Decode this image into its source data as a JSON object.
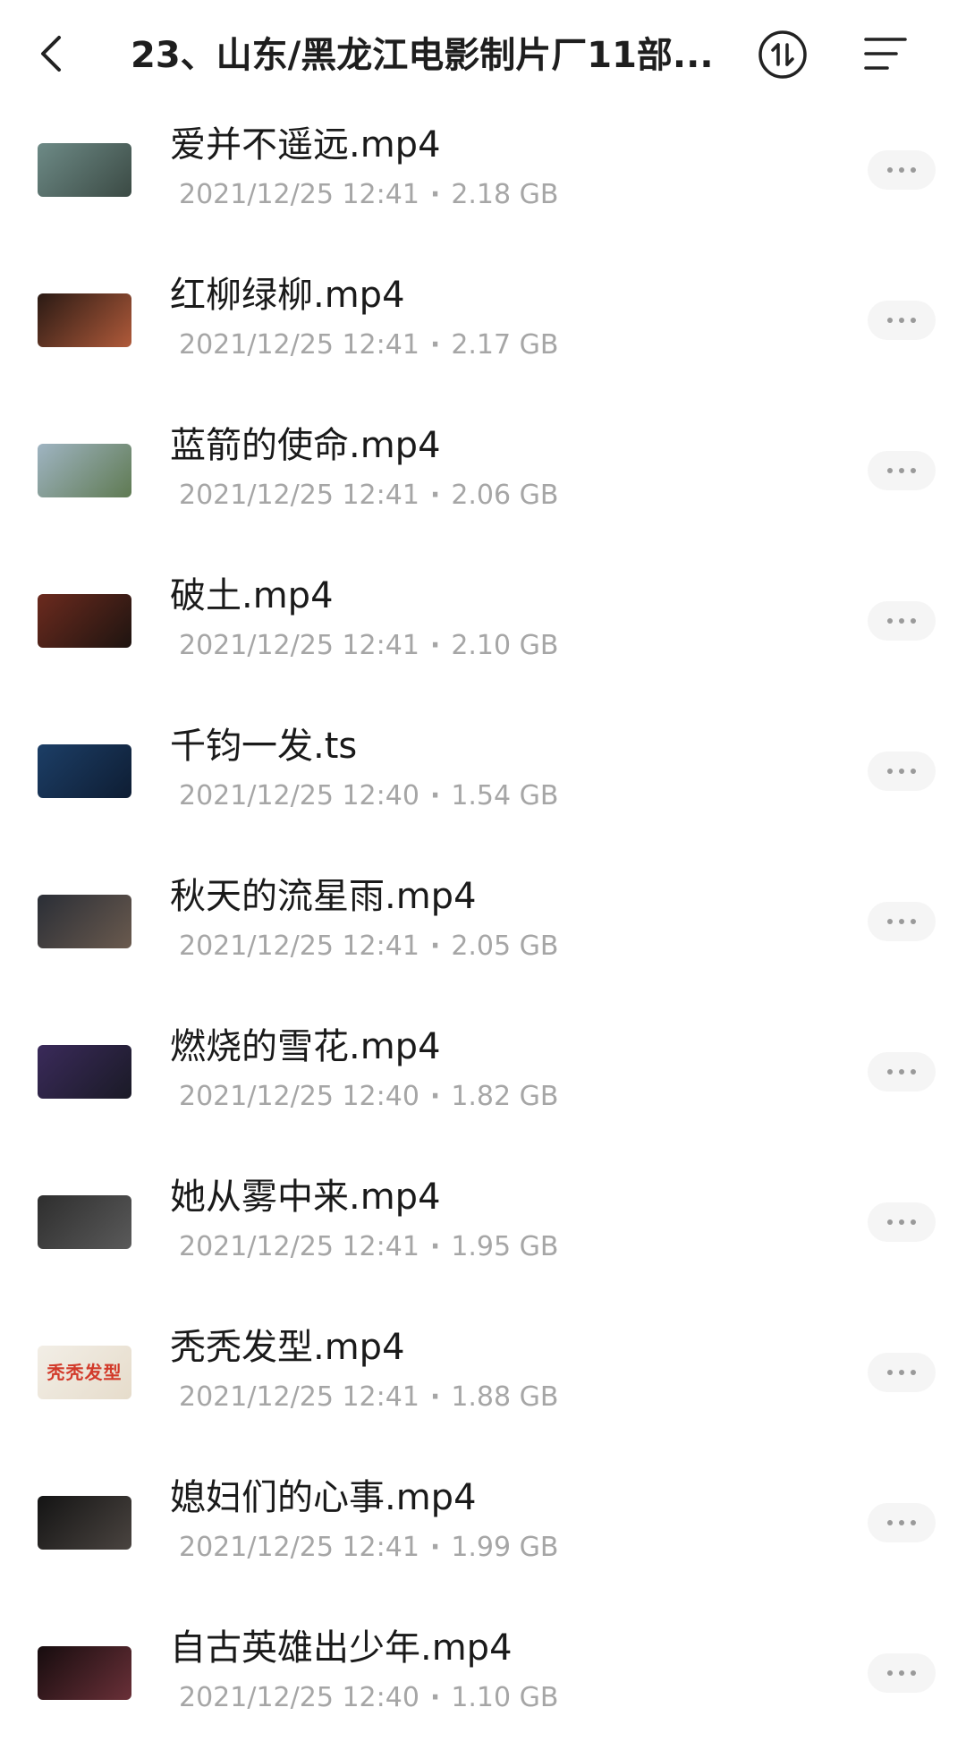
{
  "header": {
    "title": "23、山东/黑龙江电影制片厂11部...",
    "back_icon": "chevron-left-icon",
    "sort_icon": "sort-arrows-icon",
    "menu_icon": "menu-lines-icon"
  },
  "files": [
    {
      "name": "爱并不遥远.mp4",
      "date": "2021/12/25 12:41",
      "size": "2.18 GB",
      "thumb_colors": [
        "#6d8a86",
        "#3b4a44"
      ]
    },
    {
      "name": "红柳绿柳.mp4",
      "date": "2021/12/25 12:41",
      "size": "2.17 GB",
      "thumb_colors": [
        "#2a1a14",
        "#b05a3a"
      ]
    },
    {
      "name": "蓝箭的使命.mp4",
      "date": "2021/12/25 12:41",
      "size": "2.06 GB",
      "thumb_colors": [
        "#9fb4c2",
        "#5f7a52"
      ]
    },
    {
      "name": "破土.mp4",
      "date": "2021/12/25 12:41",
      "size": "2.10 GB",
      "thumb_colors": [
        "#6b2a1e",
        "#1e1410"
      ]
    },
    {
      "name": "千钧一发.ts",
      "date": "2021/12/25 12:40",
      "size": "1.54 GB",
      "thumb_colors": [
        "#1c3e66",
        "#0e1d33"
      ]
    },
    {
      "name": "秋天的流星雨.mp4",
      "date": "2021/12/25 12:41",
      "size": "2.05 GB",
      "thumb_colors": [
        "#2a2e36",
        "#6a5a4e"
      ]
    },
    {
      "name": "燃烧的雪花.mp4",
      "date": "2021/12/25 12:40",
      "size": "1.82 GB",
      "thumb_colors": [
        "#3a2a5a",
        "#1a1a26"
      ]
    },
    {
      "name": "她从雾中来.mp4",
      "date": "2021/12/25 12:41",
      "size": "1.95 GB",
      "thumb_colors": [
        "#2e2e2e",
        "#5a5a5a"
      ]
    },
    {
      "name": "秃秃发型.mp4",
      "date": "2021/12/25 12:41",
      "size": "1.88 GB",
      "thumb_colors": [
        "#f2eee6",
        "#e6dccb"
      ],
      "thumb_text": "秃秃发型"
    },
    {
      "name": "媳妇们的心事.mp4",
      "date": "2021/12/25 12:41",
      "size": "1.99 GB",
      "thumb_colors": [
        "#141414",
        "#4a4440"
      ]
    },
    {
      "name": "自古英雄出少年.mp4",
      "date": "2021/12/25 12:40",
      "size": "1.10 GB",
      "thumb_colors": [
        "#160c0e",
        "#6a3038"
      ]
    }
  ],
  "meta_separator": "·",
  "row_action_icon": "more-dots-icon"
}
